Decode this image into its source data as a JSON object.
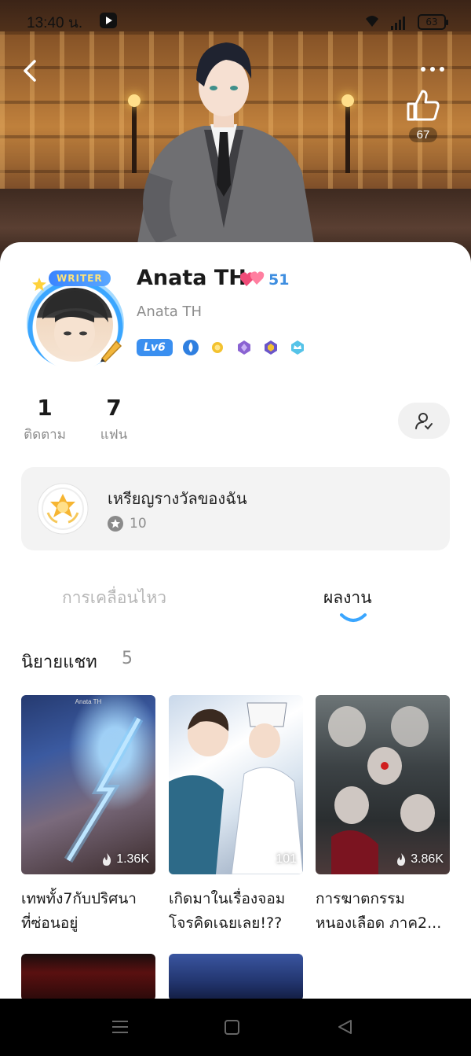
{
  "status_bar": {
    "time": "13:40 น.",
    "battery": "63"
  },
  "header": {
    "like_count": "67"
  },
  "profile": {
    "name": "Anata TH",
    "fans_level": "51",
    "username": "Anata TH",
    "writer_badge": "WRITER",
    "level_badge": "Lv6"
  },
  "stats": {
    "following_count": "1",
    "following_label": "ติดตาม",
    "fans_count": "7",
    "fans_label": "แฟน"
  },
  "medals": {
    "title": "เหรียญรางวัลของฉัน",
    "count": "10"
  },
  "tabs": [
    {
      "label": "การเคลื่อนไหว",
      "active": false
    },
    {
      "label": "ผลงาน",
      "active": true
    }
  ],
  "section": {
    "title": "นิยายแชท",
    "count": "5"
  },
  "works": [
    {
      "title_line1": "เทพทั้ง7กับปริศนา",
      "title_line2": "ที่ซ่อนอยู่",
      "reads": "1.36K",
      "watermark": "Anata TH"
    },
    {
      "title_line1": "เกิดมาในเรื่องจอม",
      "title_line2": "โจรคิดเฉยเลย!??",
      "reads": "101"
    },
    {
      "title_line1": "การฆาตกรรม",
      "title_line2": "หนองเลือด ภาค2...",
      "reads": "3.86K"
    },
    {
      "title_line1": "",
      "title_line2": ""
    },
    {
      "title_line1": "",
      "title_line2": ""
    }
  ],
  "icons": {
    "back": "back-arrow-icon",
    "more": "more-dots-icon",
    "like": "thumbs-up-icon",
    "follow": "add-user-icon",
    "medal": "medal-icon",
    "fire": "fire-icon"
  },
  "colors": {
    "accent_blue": "#3a8ff0",
    "fans_level": "#3e8ee0",
    "tab_indicator": "#3aa6ff",
    "card_bg": "#f3f3f3"
  }
}
